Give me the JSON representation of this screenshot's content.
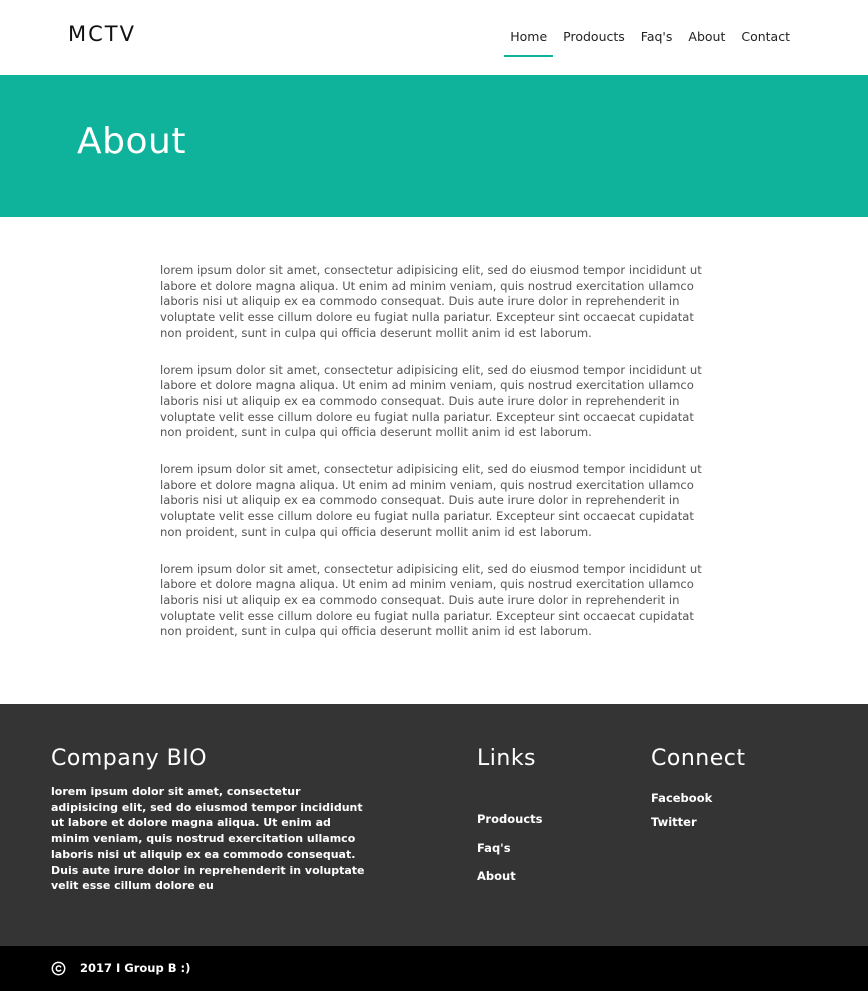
{
  "header": {
    "logo": "MCTV",
    "nav": [
      {
        "label": "Home",
        "active": true
      },
      {
        "label": "Prodoucts",
        "active": false
      },
      {
        "label": "Faq's",
        "active": false
      },
      {
        "label": "About",
        "active": false
      },
      {
        "label": "Contact",
        "active": false
      }
    ]
  },
  "hero": {
    "title": "About"
  },
  "main": {
    "paragraphs": [
      "lorem ipsum dolor sit amet, consectetur adipisicing elit, sed do eiusmod tempor incididunt ut labore et dolore magna aliqua. Ut enim ad minim veniam, quis nostrud exercitation ullamco laboris nisi ut aliquip ex ea commodo consequat. Duis aute irure dolor in reprehenderit in voluptate velit esse cillum dolore eu fugiat nulla pariatur. Excepteur sint occaecat cupidatat non proident, sunt in culpa qui officia deserunt mollit anim id est laborum.",
      "lorem ipsum dolor sit amet, consectetur adipisicing elit, sed do eiusmod tempor incididunt ut labore et dolore magna aliqua. Ut enim ad minim veniam, quis nostrud exercitation ullamco laboris nisi ut aliquip ex ea commodo consequat. Duis aute irure dolor in reprehenderit in voluptate velit esse cillum dolore eu fugiat nulla pariatur. Excepteur sint occaecat cupidatat non proident, sunt in culpa qui officia deserunt mollit anim id est laborum.",
      "lorem ipsum dolor sit amet, consectetur adipisicing elit, sed do eiusmod tempor incididunt ut labore et dolore magna aliqua. Ut enim ad minim veniam, quis nostrud exercitation ullamco laboris nisi ut aliquip ex ea commodo consequat. Duis aute irure dolor in reprehenderit in voluptate velit esse cillum dolore eu fugiat nulla pariatur. Excepteur sint occaecat cupidatat non proident, sunt in culpa qui officia deserunt mollit anim id est laborum.",
      "lorem ipsum dolor sit amet, consectetur adipisicing elit, sed do eiusmod tempor incididunt ut labore et dolore magna aliqua. Ut enim ad minim veniam, quis nostrud exercitation ullamco laboris nisi ut aliquip ex ea commodo consequat. Duis aute irure dolor in reprehenderit in voluptate velit esse cillum dolore eu fugiat nulla pariatur. Excepteur sint occaecat cupidatat non proident, sunt in culpa qui officia deserunt mollit anim id est laborum."
    ]
  },
  "footer": {
    "bio_title": "Company BIO",
    "bio_text": "lorem ipsum dolor sit amet, consectetur adipisicing elit, sed do eiusmod tempor incididunt ut labore et dolore magna aliqua. Ut enim ad minim veniam, quis nostrud exercitation ullamco laboris nisi ut aliquip ex ea commodo consequat. Duis aute irure dolor in reprehenderit in voluptate velit esse cillum dolore eu",
    "links_title": "Links",
    "links": [
      "Prodoucts",
      "Faq's",
      "About"
    ],
    "connect_title": "Connect",
    "connect": [
      "Facebook",
      "Twitter"
    ]
  },
  "bottombar": {
    "copyright_icon": "copyright-icon",
    "copyright_text": "2017 I Group B :)"
  },
  "colors": {
    "accent": "#0fb39c",
    "footer_bg": "#343434",
    "bottombar_bg": "#000000"
  }
}
